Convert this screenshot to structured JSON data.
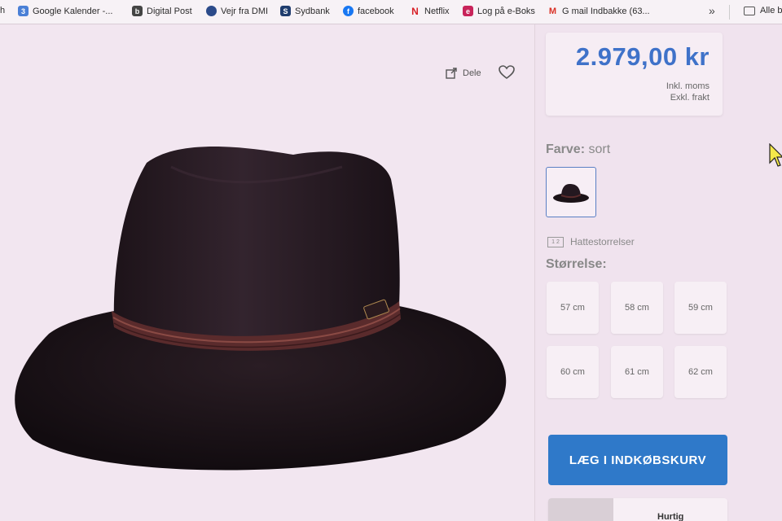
{
  "bookmarks": {
    "items": [
      {
        "label": "h",
        "icon": "cut-off-bookmark-icon"
      },
      {
        "label": "Google Kalender -...",
        "icon": "google-calendar-icon"
      },
      {
        "label": "Digital Post",
        "icon": "digital-post-icon"
      },
      {
        "label": "Vejr fra DMI",
        "icon": "dmi-icon"
      },
      {
        "label": "Sydbank",
        "icon": "sydbank-icon"
      },
      {
        "label": "facebook",
        "icon": "facebook-icon"
      },
      {
        "label": "Netflix",
        "icon": "netflix-icon"
      },
      {
        "label": "Log på e-Boks",
        "icon": "eboks-icon"
      },
      {
        "label": "G mail Indbakke (63...",
        "icon": "gmail-icon"
      }
    ],
    "more": "»",
    "folder_label": "Alle b"
  },
  "gallery": {
    "share_label": "Dele",
    "product_image": "black-fedora-hat-image"
  },
  "price": {
    "amount": "2.979,00 kr",
    "vat_note": "Inkl. moms",
    "shipping_note": "Exkl. frakt"
  },
  "color": {
    "label": "Farve:",
    "value": "sort"
  },
  "size_guide_label": "Hattestorrelser",
  "size_label": "Størrelse:",
  "sizes": [
    "57 cm",
    "58 cm",
    "59 cm",
    "60 cm",
    "61 cm",
    "62 cm"
  ],
  "cart_button": "LÆG I INDKØBSKURV",
  "quick_label": "Hurtig",
  "colors": {
    "accent": "#2f79c9",
    "price": "#3f72c9",
    "background": "#f1e6ef"
  }
}
